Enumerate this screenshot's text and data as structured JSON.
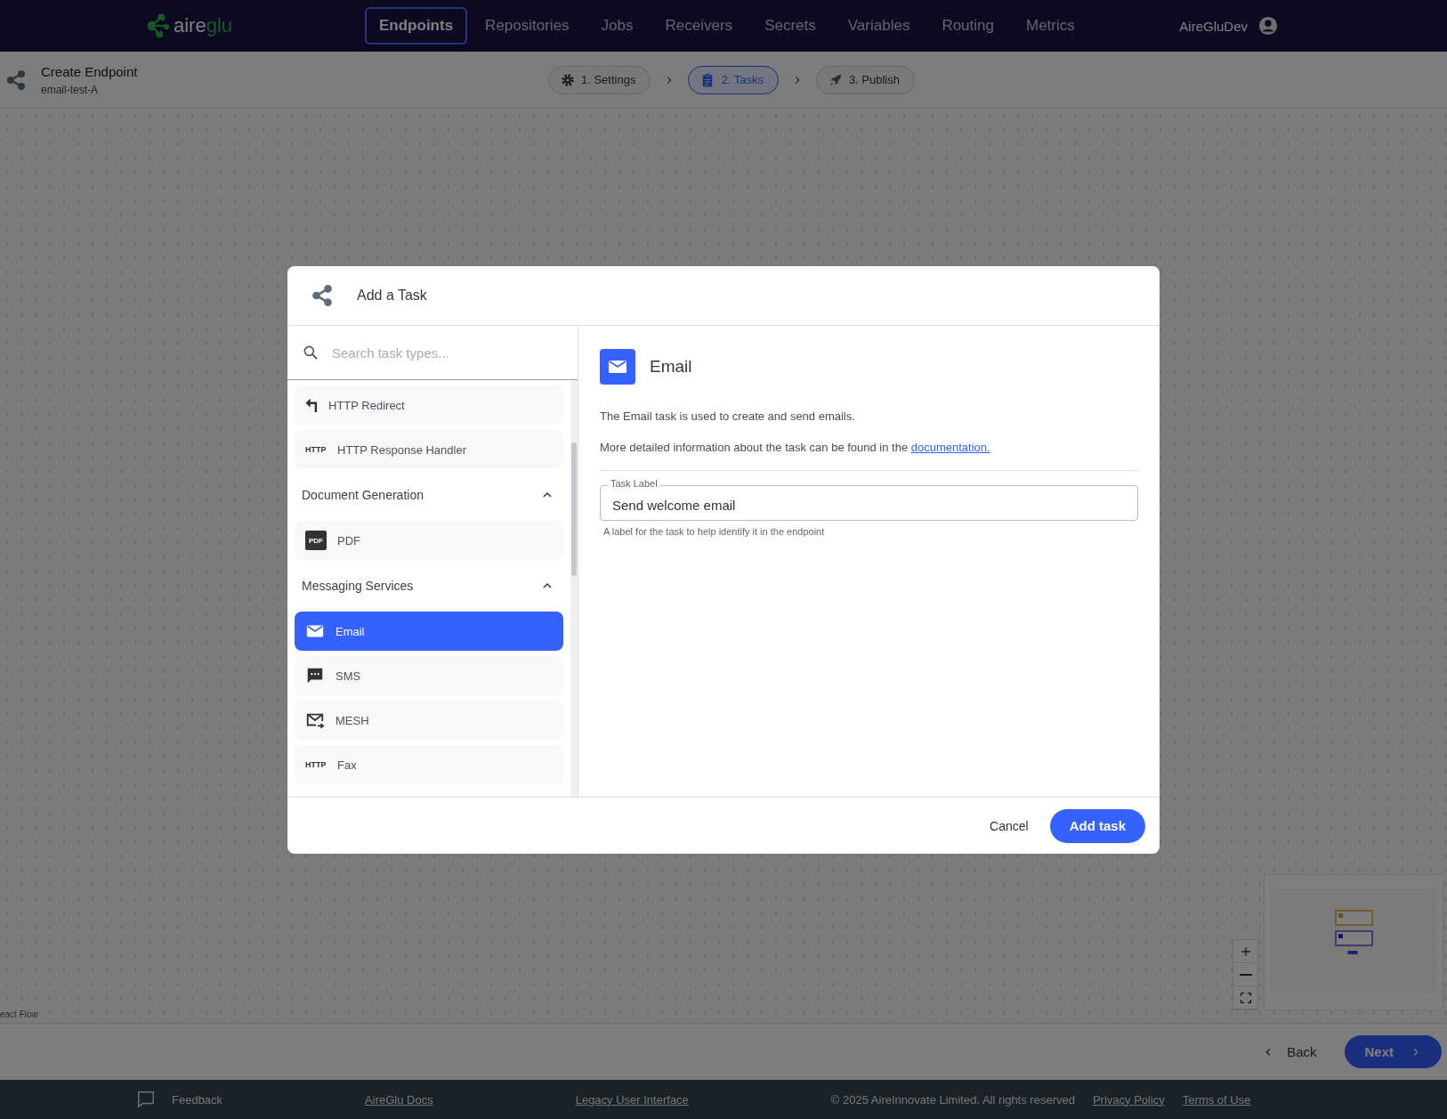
{
  "nav": {
    "logo": {
      "part_1": "aire",
      "part_2": "glu"
    },
    "tabs": [
      {
        "label": "Endpoints",
        "selected": true
      },
      {
        "label": "Repositories",
        "selected": false
      },
      {
        "label": "Jobs",
        "selected": false
      },
      {
        "label": "Receivers",
        "selected": false
      },
      {
        "label": "Secrets",
        "selected": false
      },
      {
        "label": "Variables",
        "selected": false
      },
      {
        "label": "Routing",
        "selected": false
      },
      {
        "label": "Metrics",
        "selected": false
      }
    ],
    "user": "AireGluDev"
  },
  "header": {
    "title": "Create Endpoint",
    "subtitle": "email-test-A",
    "steps": [
      {
        "label": "1. Settings",
        "kind": "gear",
        "selected": false
      },
      {
        "label": "2. Tasks",
        "kind": "clipboard",
        "selected": true
      },
      {
        "label": "3. Publish",
        "kind": "rocket",
        "selected": false
      }
    ]
  },
  "canvas": {
    "attribution": "eact Flow"
  },
  "modal": {
    "title": "Add a Task",
    "search": {
      "placeholder": "Search task types..."
    },
    "groups": [
      {
        "items": [
          {
            "label": "HTTP Redirect",
            "kind": "redirect",
            "selected": false
          },
          {
            "label": "HTTP Response Handler",
            "kind": "text",
            "icon_text": "HTTP",
            "selected": false
          }
        ]
      },
      {
        "title": "Document Generation",
        "expanded": true,
        "items": [
          {
            "label": "PDF",
            "kind": "document",
            "icon_text": "PDF",
            "selected": false
          }
        ]
      },
      {
        "title": "Messaging Services",
        "expanded": true,
        "items": [
          {
            "label": "Email",
            "kind": "email",
            "selected": true
          },
          {
            "label": "SMS",
            "kind": "sms",
            "selected": false
          },
          {
            "label": "MESH",
            "kind": "mesh",
            "selected": false
          },
          {
            "label": "Fax",
            "kind": "text",
            "icon_text": "HTTP",
            "selected": false
          }
        ]
      }
    ],
    "detail": {
      "title": "Email",
      "description": "The Email task is used to create and send emails.",
      "more": "More detailed information about the task can be found in the",
      "link": "documentation.",
      "field": {
        "label": "Task Label",
        "value": "Send welcome email",
        "helper": "A label for the task to help identify it in the endpoint"
      }
    },
    "buttons": {
      "cancel": "Cancel",
      "confirm": "Add task"
    }
  },
  "actions": {
    "back": "Back",
    "next": "Next"
  },
  "footer": {
    "feedback": "Feedback",
    "links": [
      "AireGlu Docs",
      "Legacy User Interface"
    ],
    "copyright": "© 2025 AireInnovate Limited. All rights reserved",
    "legal": [
      "Privacy Policy",
      "Terms of Use"
    ]
  }
}
